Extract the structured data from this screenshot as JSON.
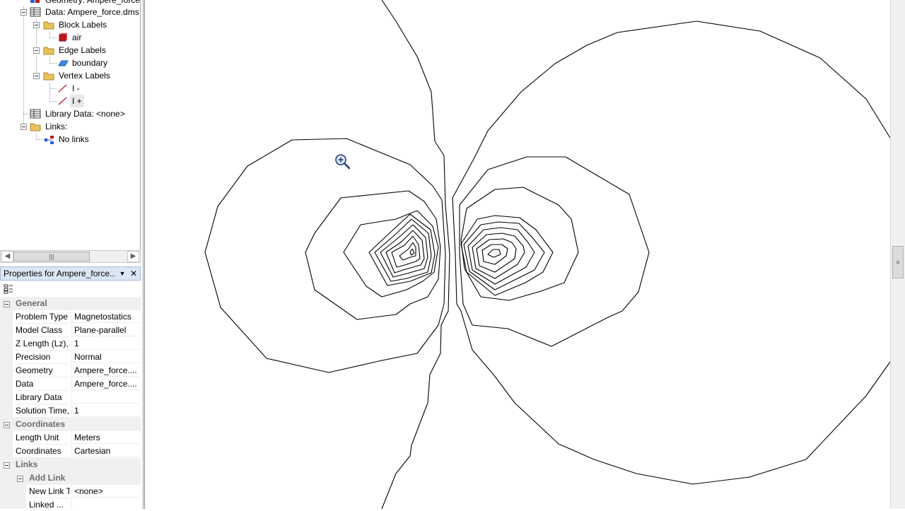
{
  "tree": {
    "items": [
      {
        "label": "Geometry: Ampere_force"
      },
      {
        "label": "Data: Ampere_force.dms"
      },
      {
        "label": "Block Labels"
      },
      {
        "label": "air"
      },
      {
        "label": "Edge Labels"
      },
      {
        "label": "boundary"
      },
      {
        "label": "Vertex Labels"
      },
      {
        "label": "I -"
      },
      {
        "label": "I +"
      },
      {
        "label": "Library Data: <none>"
      },
      {
        "label": "Links:"
      },
      {
        "label": "No links"
      }
    ]
  },
  "properties": {
    "title": "Properties for Ampere_force....",
    "categories": {
      "general": "General",
      "coordinates": "Coordinates",
      "links": "Links",
      "add_link": "Add Link"
    },
    "rows": [
      {
        "name": "Problem Type",
        "value": "Magnetostatics"
      },
      {
        "name": "Model Class",
        "value": "Plane-parallel"
      },
      {
        "name": "Z Length (Lz), m",
        "value": "1"
      },
      {
        "name": "Precision",
        "value": "Normal"
      },
      {
        "name": "Geometry",
        "value": "Ampere_force...."
      },
      {
        "name": "Data",
        "value": "Ampere_force...."
      },
      {
        "name": "Library Data",
        "value": ""
      },
      {
        "name": "Solution Time, s",
        "value": "1"
      },
      {
        "name": "Length Unit",
        "value": "Meters"
      },
      {
        "name": "Coordinates",
        "value": "Cartesian"
      },
      {
        "name": "New Link Type",
        "value": "<none>"
      },
      {
        "name": "Linked ...",
        "value": ""
      }
    ]
  },
  "colors": {
    "accent_header": "#dbe6f4",
    "folder": "#e8c35a",
    "block_label": "#c0141c",
    "edge_label": "#3a8ee6",
    "vertex_label": "#c0141c",
    "contour_line": "#000000"
  },
  "icons": {
    "geometry": "geometry-icon",
    "data": "table-icon",
    "folder": "folder-icon",
    "block_label": "block-label-icon",
    "edge_label": "edge-label-icon",
    "vertex_label": "vertex-label-icon",
    "link": "link-icon",
    "cursor": "zoom-in-cursor-icon"
  }
}
